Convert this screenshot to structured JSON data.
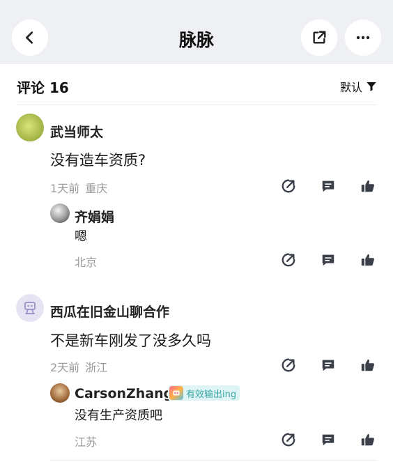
{
  "header": {
    "title": "脉脉"
  },
  "comments_header": {
    "label": "评论 16",
    "sort_label": "默认"
  },
  "comments": [
    {
      "author": "武当师太",
      "text": "没有造车资质?",
      "time": "1天前",
      "location": "重庆",
      "reply": {
        "author": "齐娟娟",
        "text": "嗯",
        "location": "北京"
      }
    },
    {
      "author": "西瓜在旧金山聊合作",
      "text": "不是新车刚发了没多久吗",
      "time": "2天前",
      "location": "浙江",
      "reply": {
        "author": "CarsonZhang",
        "badge": "有效输出ing",
        "text": "没有生产资质吧",
        "location": "江苏"
      }
    }
  ],
  "colors": {
    "header_bg": "#eef0f3",
    "icon": "#3a3f4a",
    "meta": "#9a9a9a",
    "badge_text": "#3aa6a6"
  },
  "icons": [
    "back-icon",
    "share-icon",
    "more-icon",
    "filter-icon",
    "forward-icon",
    "reply-icon",
    "like-icon"
  ]
}
